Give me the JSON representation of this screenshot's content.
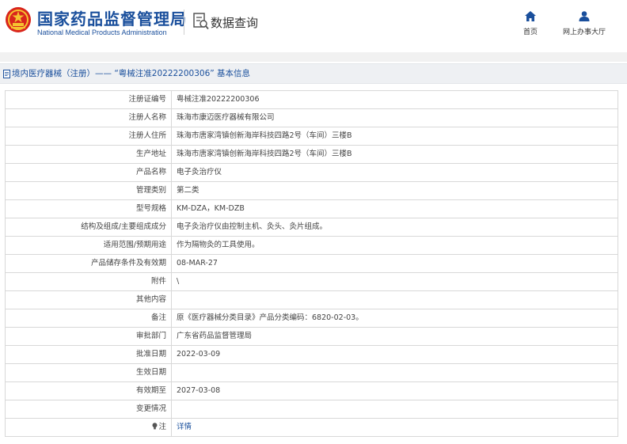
{
  "header": {
    "org_name_cn": "国家药品监督管理局",
    "org_name_en": "National Medical Products Administration",
    "section_title": "数据查询",
    "nav": [
      {
        "label": "首页",
        "icon": "home-icon"
      },
      {
        "label": "网上办事大厅",
        "icon": "user-icon"
      }
    ]
  },
  "breadcrumb": {
    "text": "境内医疗器械（注册）——  “粤械注准20222200306” 基本信息"
  },
  "colors": {
    "brand_blue": "#1a4f9c",
    "border": "#d8d8d8",
    "breadcrumb_bg": "#eef0f3"
  },
  "record": [
    {
      "label": "注册证编号",
      "value": "粤械注准20222200306"
    },
    {
      "label": "注册人名称",
      "value": "珠海市康迈医疗器械有限公司"
    },
    {
      "label": "注册人住所",
      "value": "珠海市唐家湾镇创新海岸科技四路2号（车间）三楼B"
    },
    {
      "label": "生产地址",
      "value": "珠海市唐家湾镇创新海岸科技四路2号（车间）三楼B"
    },
    {
      "label": "产品名称",
      "value": "电子灸治疗仪"
    },
    {
      "label": "管理类别",
      "value": "第二类"
    },
    {
      "label": "型号规格",
      "value": "KM-DZA，KM-DZB"
    },
    {
      "label": "结构及组成/主要组成成分",
      "value": "电子灸治疗仪由控制主机、灸头、灸片组成。"
    },
    {
      "label": "适用范围/预期用途",
      "value": "作为隔物灸的工具使用。"
    },
    {
      "label": "产品储存条件及有效期",
      "value": "08-MAR-27"
    },
    {
      "label": "附件",
      "value": "\\"
    },
    {
      "label": "其他内容",
      "value": ""
    },
    {
      "label": "备注",
      "value": "原《医疗器械分类目录》产品分类编码：6820-02-03。"
    },
    {
      "label": "审批部门",
      "value": "广东省药品监督管理局"
    },
    {
      "label": "批准日期",
      "value": "2022-03-09"
    },
    {
      "label": "生效日期",
      "value": ""
    },
    {
      "label": "有效期至",
      "value": "2027-03-08"
    },
    {
      "label": "变更情况",
      "value": ""
    }
  ],
  "note_row": {
    "label": "注",
    "icon": "bulb-icon",
    "link_text": "详情"
  }
}
